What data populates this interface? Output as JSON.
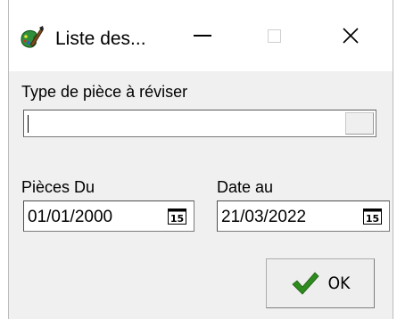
{
  "window": {
    "title": "Liste des...",
    "app_icon": "brush-palette-icon",
    "controls": {
      "minimize": "minimize-icon",
      "maximize": "maximize-icon",
      "close": "close-icon"
    },
    "close_glyph": "✕"
  },
  "form": {
    "type_label": "Type de pièce à réviser",
    "type_value": "",
    "pieces_du_label": "Pièces Du",
    "pieces_du_value": "01/01/2000",
    "date_au_label": "Date au",
    "date_au_value": "21/03/2022",
    "calendar_icon": "calendar-icon",
    "calendar_glyph": "15"
  },
  "actions": {
    "ok_label": "OK",
    "ok_icon": "checkmark-icon",
    "ok_icon_color": "#2e8b1e"
  },
  "colors": {
    "dialog_background": "#f0f0f0",
    "titlebar_background": "#ffffff"
  }
}
